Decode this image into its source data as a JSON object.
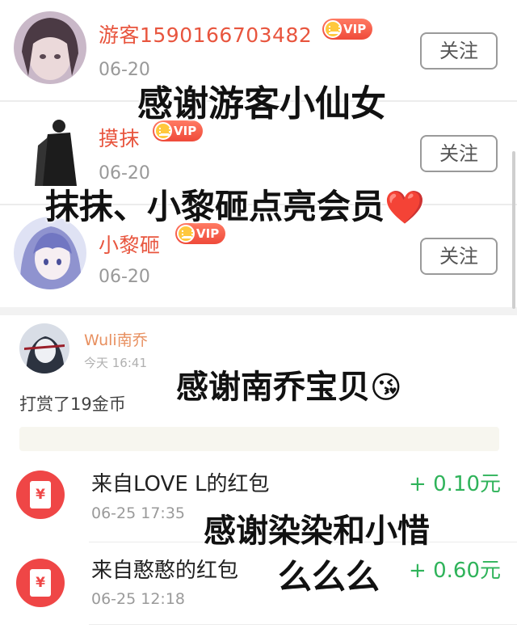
{
  "followers": [
    {
      "name": "游客1590166703482",
      "vip": "VIP",
      "date": "06-20",
      "follow_label": "关注"
    },
    {
      "name": "摸抹",
      "vip": "VIP",
      "date": "06-20",
      "follow_label": "关注"
    },
    {
      "name": "小黎砸",
      "vip": "VIP",
      "date": "06-20",
      "follow_label": "关注"
    }
  ],
  "tip": {
    "name": "Wuli南乔",
    "time": "今天 16:41",
    "text": "打赏了19金币"
  },
  "red_packets": [
    {
      "title": "来自LOVE L的红包",
      "time": "06-25 17:35",
      "amount": "+ 0.10元"
    },
    {
      "title": "来自憨憨的红包",
      "time": "06-25 12:18",
      "amount": "+ 0.60元"
    }
  ],
  "red_packet_symbol": "¥",
  "overlays": {
    "line1": "感谢游客小仙女",
    "line2": "抹抹、小黎砸点亮会员",
    "line2_emoji": "❤️",
    "line3": "感谢南乔宝贝",
    "line3_emoji": "😘",
    "line4": "感谢染染和小惜",
    "line5": "么么么"
  },
  "colors": {
    "username": "#e8553e",
    "vip": "#ef4a3a",
    "amount": "#2fb35a",
    "red_packet": "#ef4646"
  },
  "icons": [
    "crown-icon",
    "heart-icon",
    "kiss-emoji-icon",
    "red-packet-icon"
  ]
}
